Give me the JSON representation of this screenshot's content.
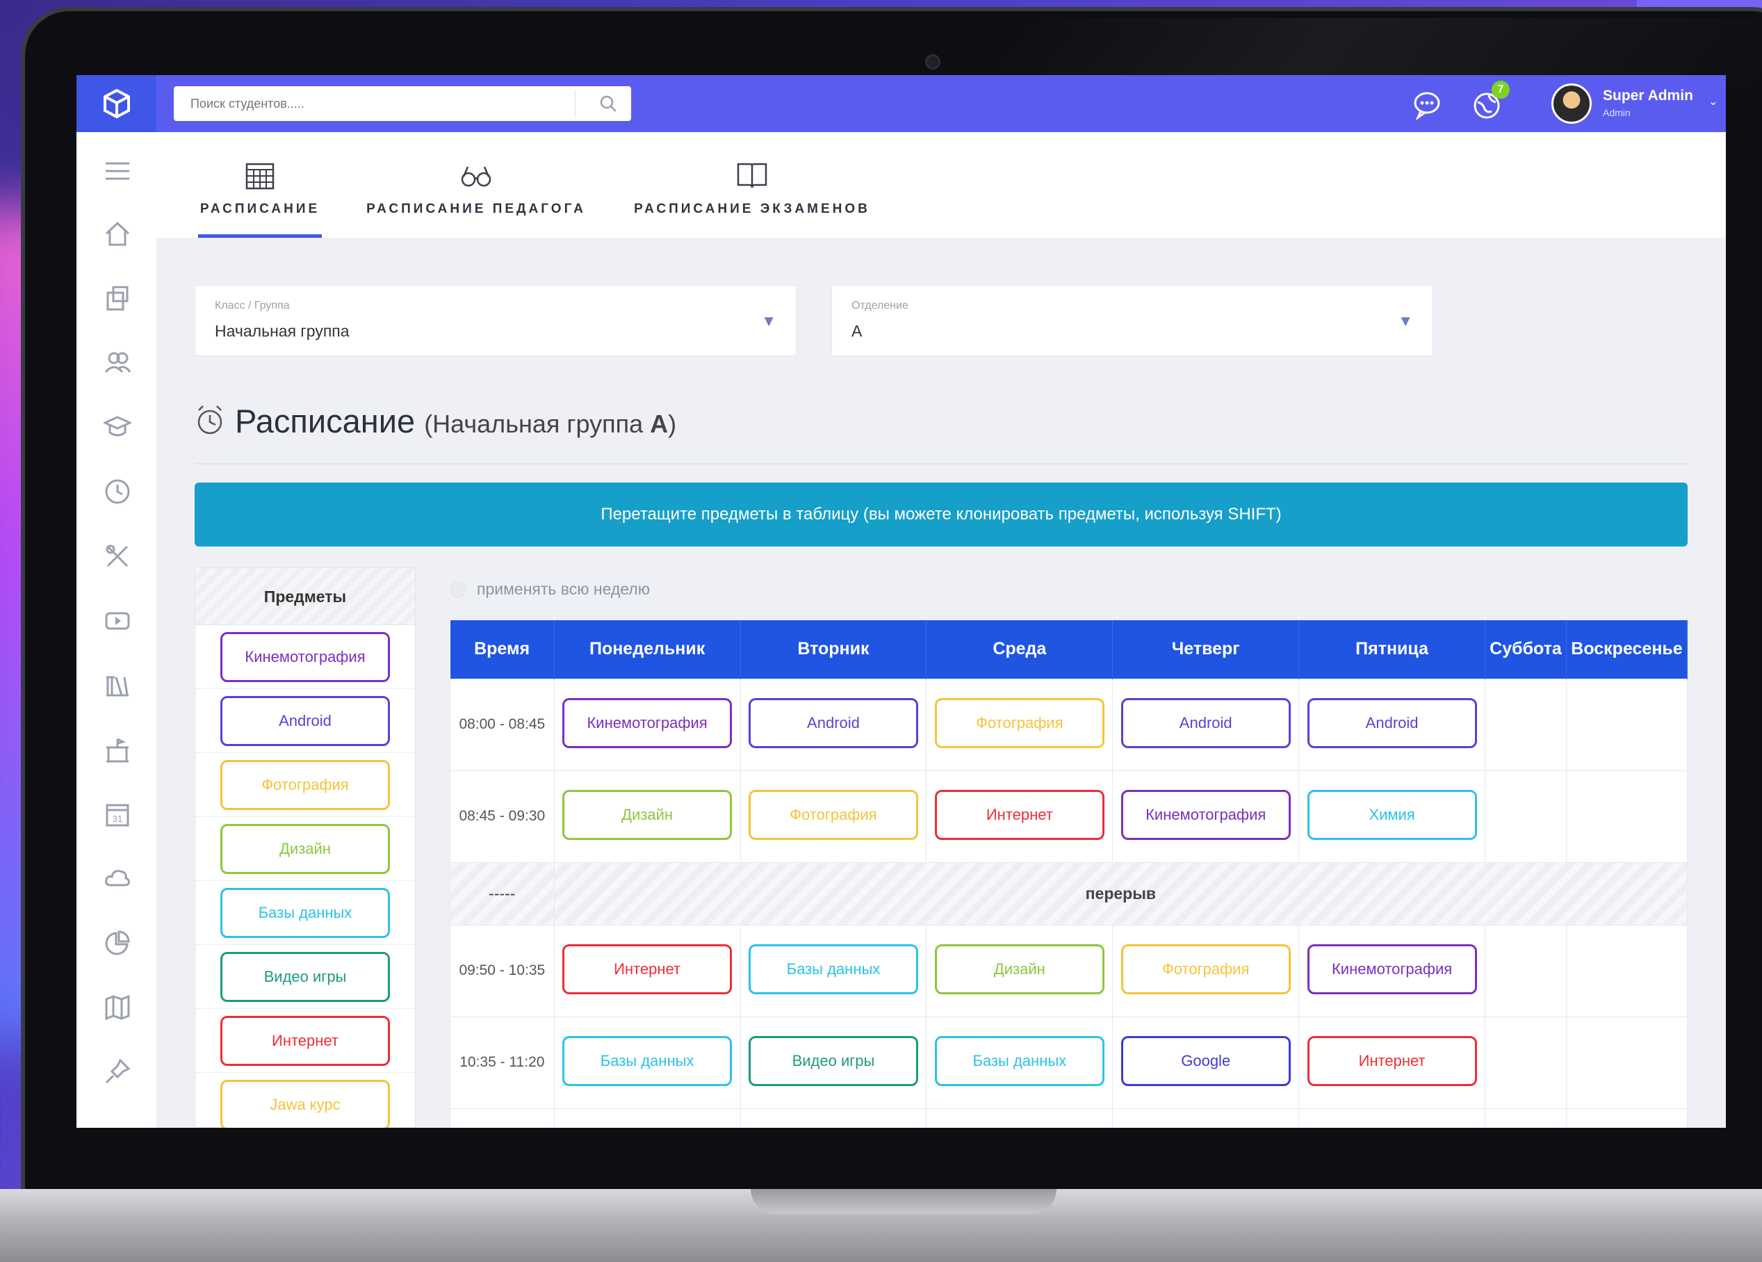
{
  "colors": {
    "topbar": "#5a5cf0",
    "logo_bg": "#3f57e6",
    "header_blue": "#1f55e0",
    "banner": "#169fc8",
    "purple": "#7b2fbe",
    "violet": "#5b3fd6",
    "yellow": "#f5c33b",
    "green": "#8dc63f",
    "cyan": "#2cc2e8",
    "teal": "#1e9a7e",
    "red": "#ee2d3a",
    "indigo": "#3d3ad6",
    "badge": "#7ed321"
  },
  "topbar": {
    "search_placeholder": "Поиск студентов.....",
    "icons": [
      "logo-cube-icon",
      "search-icon",
      "chat-icon",
      "globe-icon"
    ],
    "notification_count": "7",
    "user_name": "Super Admin",
    "user_role": "Admin"
  },
  "sidebar": {
    "icons": [
      "menu-icon",
      "home-icon",
      "contacts-icon",
      "users-icon",
      "graduation-cap-icon",
      "clock-icon",
      "tools-icon",
      "video-icon",
      "library-icon",
      "school-icon",
      "calendar-icon",
      "cloud-icon",
      "chart-pie-icon",
      "map-icon",
      "pin-icon"
    ]
  },
  "tabs": [
    {
      "label": "РАСПИСАНИЕ",
      "icon": "calendar-grid-icon",
      "active": true
    },
    {
      "label": "РАСПИСАНИЕ ПЕДАГОГА",
      "icon": "glasses-icon",
      "active": false
    },
    {
      "label": "РАСПИСАНИЕ ЭКЗАМЕНОВ",
      "icon": "book-icon",
      "active": false
    }
  ],
  "filters": {
    "class": {
      "label": "Класс / Группа",
      "value": "Начальная группа"
    },
    "department": {
      "label": "Отделение",
      "value": "A"
    }
  },
  "title": {
    "main": "Расписание",
    "sub_prefix": "(Начальная группа ",
    "sub_bold": "A",
    "sub_suffix": ")"
  },
  "banner": "Перетащите предметы в таблицу (вы можете клонировать предметы, используя SHIFT)",
  "apply_week": "применять всю неделю",
  "subjects_header": "Предметы",
  "subjects": [
    {
      "name": "Кинемотография",
      "color": "purple"
    },
    {
      "name": "Android",
      "color": "violet"
    },
    {
      "name": "Фотография",
      "color": "yellow"
    },
    {
      "name": "Дизайн",
      "color": "green"
    },
    {
      "name": "Базы данных",
      "color": "cyan"
    },
    {
      "name": "Видео игры",
      "color": "teal"
    },
    {
      "name": "Интернет",
      "color": "red"
    },
    {
      "name": "Jawa курс",
      "color": "yellow"
    }
  ],
  "schedule": {
    "headers": [
      "Время",
      "Понедельник",
      "Вторник",
      "Среда",
      "Четверг",
      "Пятница",
      "Суббота",
      "Воскресенье"
    ],
    "break_time": "-----",
    "break_label": "перерыв",
    "rows": [
      {
        "time": "08:00 - 08:45",
        "cells": [
          {
            "name": "Кинемотография",
            "color": "purple"
          },
          {
            "name": "Android",
            "color": "violet"
          },
          {
            "name": "Фотография",
            "color": "yellow"
          },
          {
            "name": "Android",
            "color": "violet"
          },
          {
            "name": "Android",
            "color": "violet"
          }
        ]
      },
      {
        "time": "08:45 - 09:30",
        "cells": [
          {
            "name": "Дизайн",
            "color": "green"
          },
          {
            "name": "Фотография",
            "color": "yellow"
          },
          {
            "name": "Интернет",
            "color": "red"
          },
          {
            "name": "Кинемотография",
            "color": "purple"
          },
          {
            "name": "Химия",
            "color": "cyan"
          }
        ]
      },
      {
        "time": "09:50 - 10:35",
        "cells": [
          {
            "name": "Интернет",
            "color": "red"
          },
          {
            "name": "Базы данных",
            "color": "cyan"
          },
          {
            "name": "Дизайн",
            "color": "green"
          },
          {
            "name": "Фотография",
            "color": "yellow"
          },
          {
            "name": "Кинемотография",
            "color": "purple"
          }
        ]
      },
      {
        "time": "10:35 - 11:20",
        "cells": [
          {
            "name": "Базы данных",
            "color": "cyan"
          },
          {
            "name": "Видео игры",
            "color": "teal"
          },
          {
            "name": "Базы данных",
            "color": "cyan"
          },
          {
            "name": "Google",
            "color": "indigo"
          },
          {
            "name": "Интернет",
            "color": "red"
          }
        ]
      }
    ]
  }
}
